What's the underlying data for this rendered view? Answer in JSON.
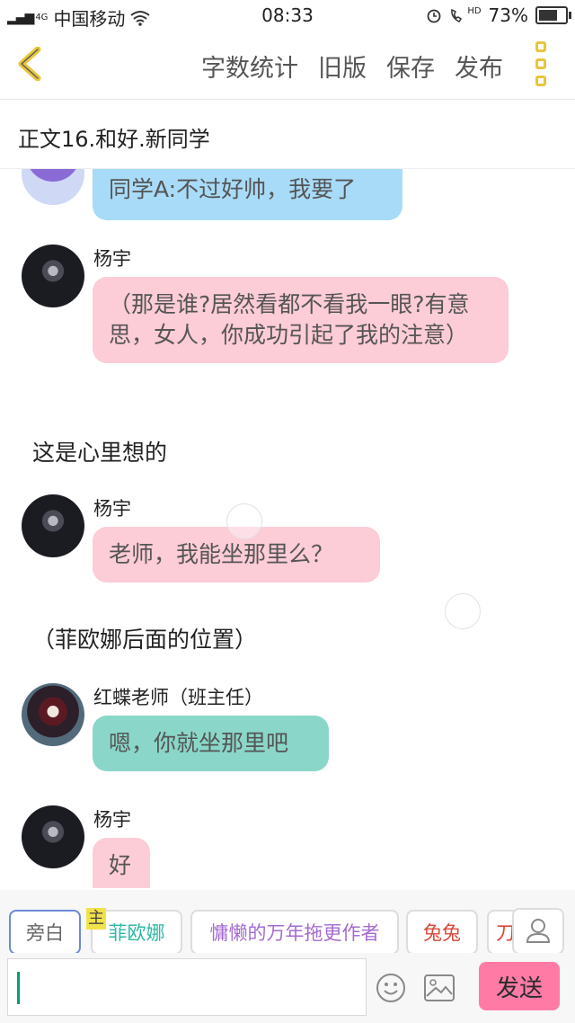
{
  "status_bar": {
    "network": "4G",
    "carrier": "中国移动",
    "time": "08:33",
    "hd": "HD",
    "battery_percent": "73%",
    "battery_level": 0.73
  },
  "toolbar": {
    "actions": [
      "字数统计",
      "旧版",
      "保存",
      "发布"
    ],
    "accent_color": "#e8c63b"
  },
  "chapter_title": "正文16.和好.新同学",
  "messages": [
    {
      "speaker": "",
      "text": "同学A:不过好帅，我要了",
      "color": "#a8dbf7"
    },
    {
      "speaker": "杨宇",
      "text": "（那是谁?居然看都不看我一眼?有意思，女人，你成功引起了我的注意）",
      "color": "#fcccd7"
    },
    {
      "narration": "这是心里想的"
    },
    {
      "speaker": "杨宇",
      "text": "老师，我能坐那里么？",
      "color": "#fcccd7"
    },
    {
      "narration": "（菲欧娜后面的位置）"
    },
    {
      "speaker": "红蝶老师（班主任）",
      "text": "嗯，你就坐那里吧",
      "color": "#8ad7c9"
    },
    {
      "speaker": "杨宇",
      "text": "好",
      "color": "#fcccd7"
    }
  ],
  "roles": {
    "narrator": "旁白",
    "main_tag": "主",
    "chips": [
      {
        "label": "菲欧娜",
        "color": "#2fb8a6"
      },
      {
        "label": "慵懒的万年拖更作者",
        "color": "#a56bd0"
      },
      {
        "label": "兔兔",
        "color": "#d8483a"
      },
      {
        "label": "刀",
        "color": "#d8483a"
      }
    ]
  },
  "input": {
    "value": "",
    "send_label": "发送"
  }
}
